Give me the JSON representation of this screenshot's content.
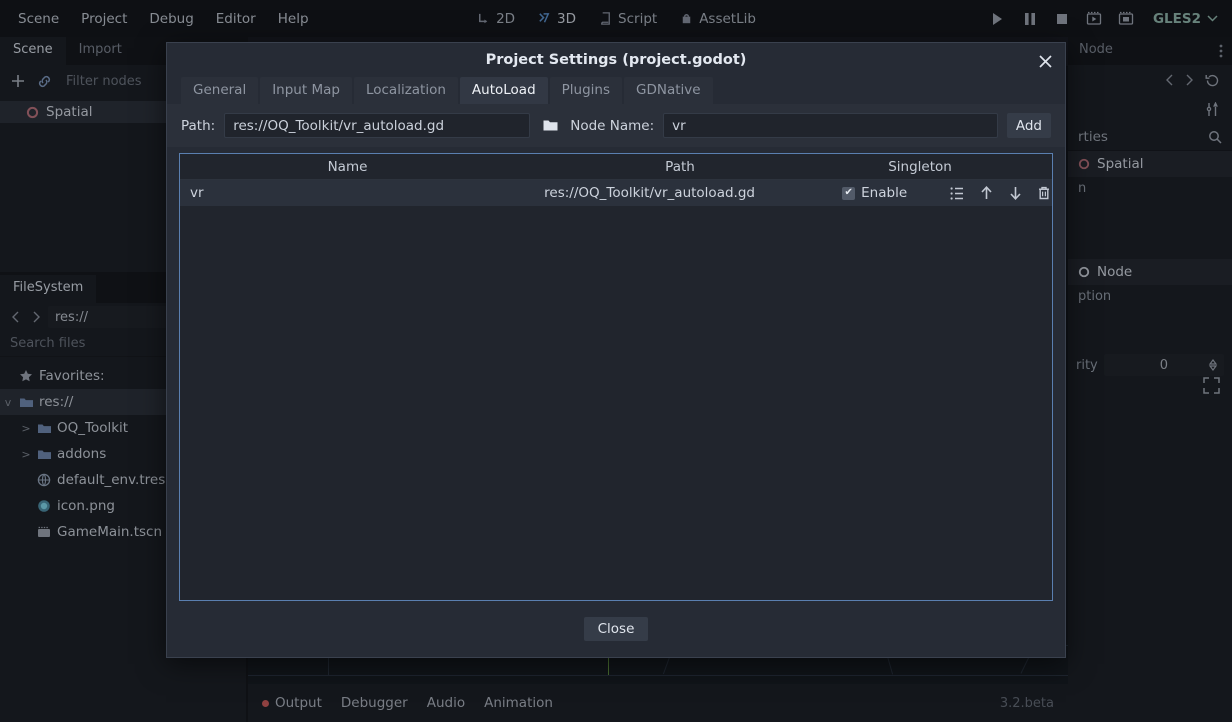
{
  "menubar": {
    "left_items": [
      {
        "label": "Scene"
      },
      {
        "label": "Project"
      },
      {
        "label": "Debug"
      },
      {
        "label": "Editor"
      },
      {
        "label": "Help"
      }
    ],
    "center_items": [
      {
        "label": "2D",
        "icon": "2d-icon",
        "active": false
      },
      {
        "label": "3D",
        "icon": "3d-icon",
        "active": true
      },
      {
        "label": "Script",
        "icon": "script-icon",
        "active": false
      },
      {
        "label": "AssetLib",
        "icon": "assetlib-icon",
        "active": false
      }
    ],
    "right": {
      "play_icon": "play-icon",
      "pause_icon": "pause-icon",
      "stop_icon": "stop-icon",
      "play_scene_icon": "play-scene-icon",
      "play_custom_icon": "play-custom-scene-icon",
      "renderer": "GLES2",
      "renderer_caret": "chevron-down-icon"
    }
  },
  "scene_dock": {
    "tabs": [
      {
        "label": "Scene",
        "active": true
      },
      {
        "label": "Import",
        "active": false
      }
    ],
    "toolbar": {
      "add_icon": "plus-icon",
      "link_icon": "link-icon",
      "filter_placeholder": "Filter nodes"
    },
    "tree": [
      {
        "label": "Spatial",
        "icon": "spatial-node-icon",
        "selected": true
      }
    ]
  },
  "filesystem_dock": {
    "tab": "FileSystem",
    "back_icon": "chevron-left-icon",
    "forward_icon": "chevron-right-icon",
    "path": "res://",
    "search_placeholder": "Search files",
    "items": [
      {
        "label": "Favorites:",
        "icon": "star-icon",
        "indent": 0,
        "expander": "",
        "selected": false
      },
      {
        "label": "res://",
        "icon": "folder-icon",
        "indent": 0,
        "expander": "v",
        "selected": true
      },
      {
        "label": "OQ_Toolkit",
        "icon": "folder-icon",
        "indent": 1,
        "expander": ">",
        "selected": false
      },
      {
        "label": "addons",
        "icon": "folder-icon",
        "indent": 1,
        "expander": ">",
        "selected": false
      },
      {
        "label": "default_env.tres",
        "icon": "environment-icon",
        "indent": 1,
        "expander": "",
        "selected": false
      },
      {
        "label": "icon.png",
        "icon": "image-icon",
        "indent": 1,
        "expander": "",
        "selected": false
      },
      {
        "label": "GameMain.tscn",
        "icon": "scene-icon",
        "indent": 1,
        "expander": "",
        "selected": false
      }
    ]
  },
  "inspector": {
    "tabs": [
      {
        "label": "Node",
        "active": false
      }
    ],
    "menu_icon": "vertical-dots-icon",
    "back_icon": "chevron-left-icon",
    "forward_icon": "chevron-right-icon",
    "history_icon": "history-icon",
    "tools_icon": "object-tools-icon",
    "search_label": "rties",
    "search_icon": "search-icon",
    "sections": [
      {
        "label": "Spatial",
        "icon": "spatial-node-icon"
      },
      {
        "label": "n",
        "icon": ""
      },
      {
        "label": "Node",
        "icon": "node-icon"
      },
      {
        "label": "ption",
        "icon": ""
      }
    ],
    "property": {
      "label": "rity",
      "value": "0",
      "spinner_icon": "spinner-icon"
    },
    "expand_icon": "expand-icon"
  },
  "bottom_panel": {
    "tabs": [
      {
        "label": "Output",
        "has_error_dot": true
      },
      {
        "label": "Debugger",
        "has_error_dot": false
      },
      {
        "label": "Audio",
        "has_error_dot": false
      },
      {
        "label": "Animation",
        "has_error_dot": false
      }
    ],
    "version": "3.2.beta"
  },
  "dialog": {
    "title": "Project Settings (project.godot)",
    "close_icon": "close-icon",
    "tabs": [
      {
        "label": "General",
        "active": false
      },
      {
        "label": "Input Map",
        "active": false
      },
      {
        "label": "Localization",
        "active": false
      },
      {
        "label": "AutoLoad",
        "active": true
      },
      {
        "label": "Plugins",
        "active": false
      },
      {
        "label": "GDNative",
        "active": false
      }
    ],
    "form": {
      "path_label": "Path:",
      "path_value": "res://OQ_Toolkit/vr_autoload.gd",
      "browse_icon": "folder-icon",
      "node_name_label": "Node Name:",
      "node_name_value": "vr",
      "add_label": "Add"
    },
    "table": {
      "columns": [
        "Name",
        "Path",
        "Singleton"
      ],
      "rows": [
        {
          "name": "vr",
          "path": "res://OQ_Toolkit/vr_autoload.gd",
          "singleton_checked": true,
          "singleton_label": "Enable",
          "actions": [
            "list-icon",
            "move-up-icon",
            "move-down-icon",
            "delete-icon"
          ]
        }
      ]
    },
    "footer": {
      "close_label": "Close"
    }
  },
  "colors": {
    "accent": "#5a7fb0",
    "dialog_bg": "#262b35",
    "editor_bg": "#1c2027",
    "text": "#c6ccd6",
    "error_dot": "#c75b5b",
    "gles_text": "#8fb5ab",
    "grid_axis_green": "#7fbf4f"
  }
}
